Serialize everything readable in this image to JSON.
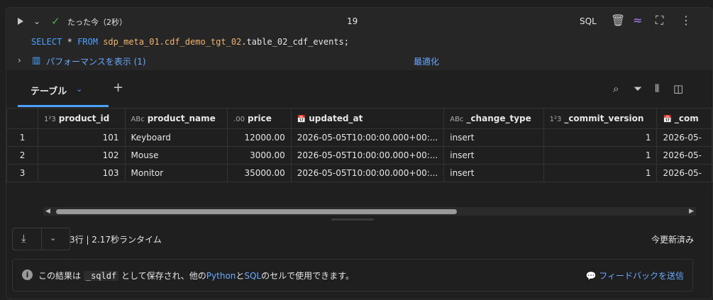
{
  "cell": {
    "status": "たった今（2秒）",
    "count": "19",
    "language": "SQL",
    "code": {
      "kw_select": "SELECT",
      "star": "*",
      "kw_from": "FROM",
      "table": "sdp_meta_01.cdf_demo_tgt_02",
      "rest": ".table_02_cdf_events;"
    },
    "perf_label": "パフォーマンスを表示 (1)",
    "optimize": "最適化"
  },
  "results": {
    "tab_label": "テーブル",
    "columns": [
      {
        "icon": "1²3",
        "name": "product_id"
      },
      {
        "icon": "ABc",
        "name": "product_name"
      },
      {
        "icon": ".00",
        "name": "price"
      },
      {
        "icon": "cal",
        "name": "updated_at"
      },
      {
        "icon": "ABc",
        "name": "_change_type"
      },
      {
        "icon": "1²3",
        "name": "_commit_version"
      },
      {
        "icon": "cal",
        "name": "_com"
      }
    ],
    "rows": [
      {
        "n": "1",
        "product_id": "101",
        "product_name": "Keyboard",
        "price": "12000.00",
        "updated_at": "2026-05-05T10:00:00.000+00:...",
        "change_type": "insert",
        "commit_version": "1",
        "commit_ts": "2026-05-"
      },
      {
        "n": "2",
        "product_id": "102",
        "product_name": "Mouse",
        "price": "3000.00",
        "updated_at": "2026-05-05T10:00:00.000+00:...",
        "change_type": "insert",
        "commit_version": "1",
        "commit_ts": "2026-05-"
      },
      {
        "n": "3",
        "product_id": "103",
        "product_name": "Monitor",
        "price": "35000.00",
        "updated_at": "2026-05-05T10:00:00.000+00:...",
        "change_type": "insert",
        "commit_version": "1",
        "commit_ts": "2026-05-"
      }
    ],
    "row_info": "3行 | 2.17秒ランタイム",
    "updated": "今更新済み"
  },
  "notice": {
    "prefix": "この結果は",
    "var": "_sqldf",
    "middle": "として保存され、他の",
    "python": "Python",
    "and": "と",
    "sql": "SQL",
    "suffix": "のセルで使用できます。",
    "feedback": "フィードバックを送信"
  }
}
